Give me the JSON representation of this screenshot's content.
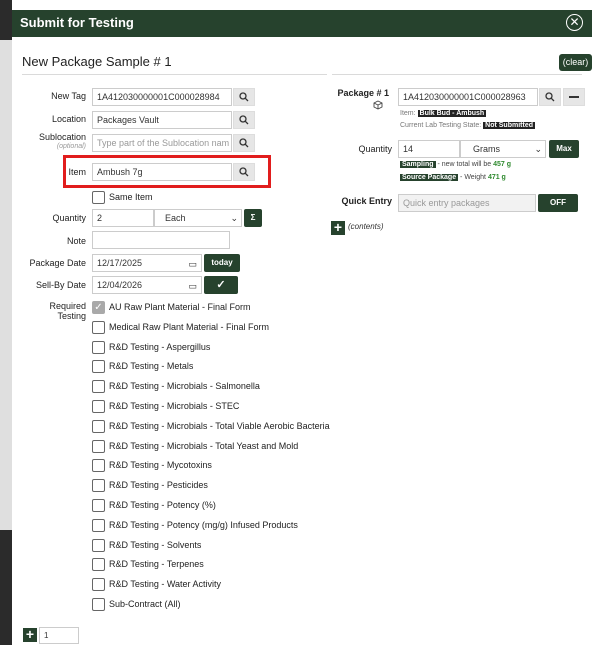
{
  "dialog": {
    "title": "Submit for Testing",
    "close_icon": "circle-x-icon"
  },
  "sample": {
    "title": "New Package Sample # 1",
    "clear_label": "(clear)"
  },
  "form": {
    "new_tag_label": "New Tag",
    "new_tag_value": "1A412030000001C000028984",
    "location_label": "Location",
    "location_value": "Packages Vault",
    "sublocation_label": "Sublocation",
    "sublocation_optional": "(optional)",
    "sublocation_placeholder": "Type part of the Sublocation nam",
    "item_label": "Item",
    "item_value": "Ambush 7g",
    "same_item_label": "Same Item",
    "quantity_label": "Quantity",
    "quantity_value": "2",
    "unit_value": "Each",
    "sigma_label": "Σ",
    "note_label": "Note",
    "note_value": "",
    "package_date_label": "Package Date",
    "package_date_value": "12/17/2025",
    "today_label": "today",
    "sellby_label": "Sell-By Date",
    "sellby_value": "12/04/2026",
    "sellby_check": "✓",
    "required_label": "Required",
    "testing_label": "Testing"
  },
  "tests": [
    {
      "label": "AU Raw Plant Material - Final Form",
      "checked": true
    },
    {
      "label": "Medical Raw Plant Material - Final Form",
      "checked": false
    },
    {
      "label": "R&D Testing - Aspergillus",
      "checked": false
    },
    {
      "label": "R&D Testing - Metals",
      "checked": false
    },
    {
      "label": "R&D Testing - Microbials - Salmonella",
      "checked": false
    },
    {
      "label": "R&D Testing - Microbials - STEC",
      "checked": false
    },
    {
      "label": "R&D Testing - Microbials - Total Viable Aerobic Bacteria",
      "checked": false
    },
    {
      "label": "R&D Testing - Microbials - Total Yeast and Mold",
      "checked": false
    },
    {
      "label": "R&D Testing - Mycotoxins",
      "checked": false
    },
    {
      "label": "R&D Testing - Pesticides",
      "checked": false
    },
    {
      "label": "R&D Testing - Potency (%)",
      "checked": false
    },
    {
      "label": "R&D Testing - Potency (mg/g) Infused Products",
      "checked": false
    },
    {
      "label": "R&D Testing - Solvents",
      "checked": false
    },
    {
      "label": "R&D Testing - Terpenes",
      "checked": false
    },
    {
      "label": "R&D Testing - Water Activity",
      "checked": false
    },
    {
      "label": "Sub-Contract (All)",
      "checked": false
    }
  ],
  "package": {
    "label": "Package # 1",
    "tag_value": "1A412030000001C000028963",
    "item_prefix": "Item:",
    "item_tag": "Bulk Bud - Ambush",
    "lab_state_prefix": "Current Lab Testing State:",
    "lab_state_tag": "Not Submitted",
    "quantity_label": "Quantity",
    "quantity_value": "14",
    "unit_value": "Grams",
    "max_label": "Max",
    "sampling_tag": "Sampling",
    "sampling_text": "- new total will be",
    "sampling_value": "457 g",
    "source_tag": "Source Package",
    "source_text": "- Weight",
    "source_value": "471 g",
    "quick_entry_label": "Quick Entry",
    "quick_entry_placeholder": "Quick entry packages",
    "off_label": "OFF",
    "contents_label": "(contents)"
  },
  "footer": {
    "count_value": "1"
  }
}
